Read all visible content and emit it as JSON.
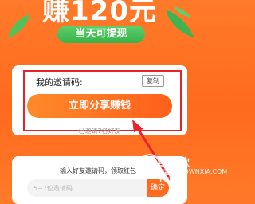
{
  "hero": {
    "headline": "赚120元",
    "badge": "当天可提现"
  },
  "invite_card": {
    "code_label": "我的邀请码:",
    "copy_label": "复制",
    "share_button": "立即分享赚钱",
    "invited_note": "已邀请7名好友"
  },
  "redeem_card": {
    "instruction": "输入好友邀请码，领取红包",
    "input_placeholder": "5~7位邀请码",
    "confirm_label": "确定"
  },
  "watermark": {
    "name": "当下软件园",
    "url": "WWW.DOWNXIA.COM"
  },
  "colors": {
    "background": "#ff6a1e",
    "badge_green": "#37b34a",
    "highlight_red": "#e8232b",
    "button_orange": "#ff5f1a"
  }
}
